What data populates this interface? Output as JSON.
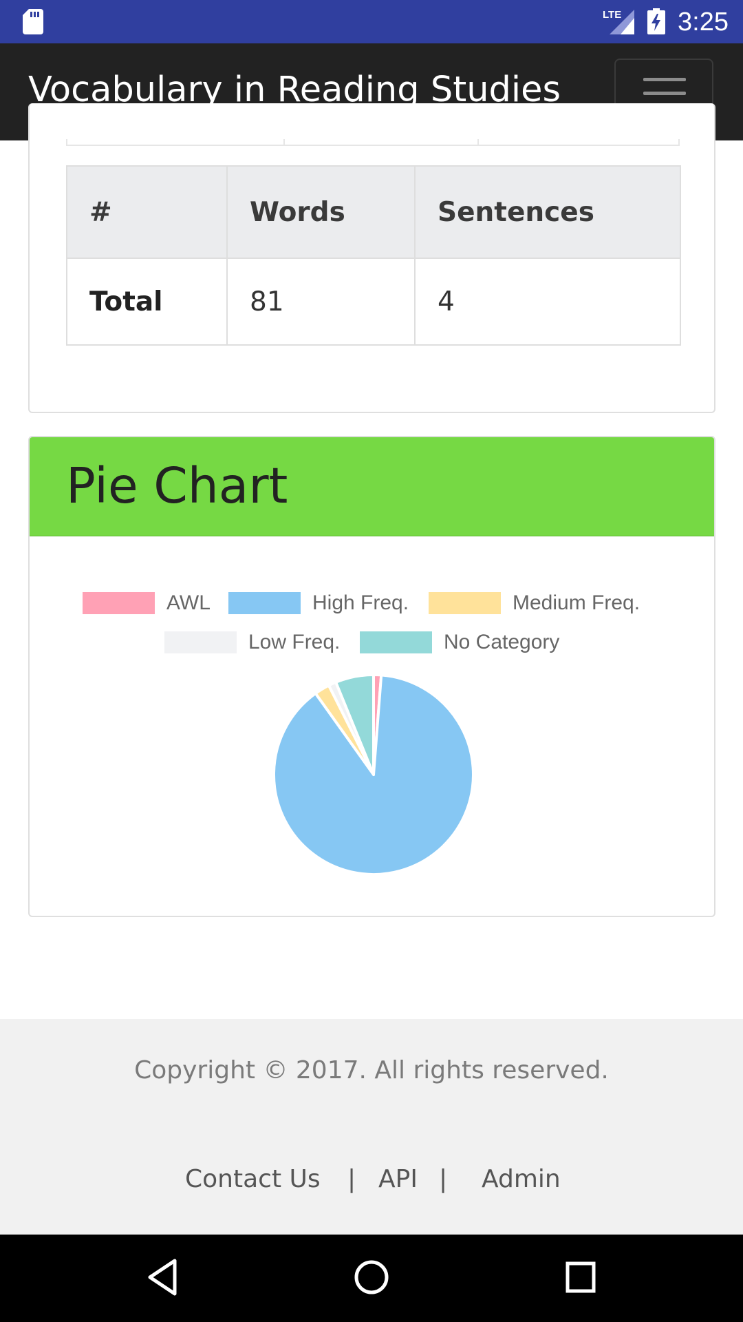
{
  "status_bar": {
    "time": "3:25",
    "network": "LTE",
    "icons": [
      "sd-card-icon",
      "lte-signal-icon",
      "battery-charging-icon"
    ]
  },
  "navbar": {
    "brand": "Vocabulary in Reading Studies",
    "toggler_icon": "hamburger-menu-icon"
  },
  "counts_table": {
    "headers": [
      "#",
      "Words",
      "Sentences"
    ],
    "rows": [
      {
        "label": "Total",
        "words": "81",
        "sentences": "4"
      }
    ]
  },
  "pie_card": {
    "title": "Pie Chart"
  },
  "chart_data": {
    "type": "pie",
    "legend_position": "top",
    "labels": [
      "AWL",
      "High Freq.",
      "Medium Freq.",
      "Low Freq.",
      "No Category"
    ],
    "values": [
      1,
      72,
      2,
      1,
      5
    ],
    "colors": [
      "#ffa1b5",
      "#86c7f3",
      "#ffe29a",
      "#f1f2f4",
      "#93d9d9"
    ]
  },
  "footer": {
    "copyright": "Copyright © 2017. All rights reserved.",
    "links": [
      "Contact Us",
      "API",
      "Admin"
    ],
    "separator": "|"
  },
  "system_nav": {
    "icons": [
      "back-icon",
      "home-icon",
      "recents-icon"
    ]
  }
}
